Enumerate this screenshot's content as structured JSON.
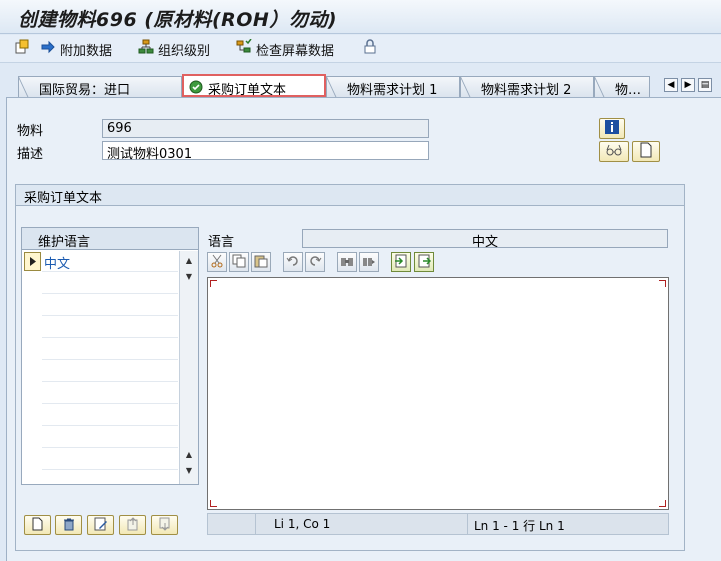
{
  "window": {
    "title": "创建物料696 (原材料(ROH）勿动)"
  },
  "toolbar": {
    "items": [
      {
        "label": "",
        "icon": "new-doc-icon"
      },
      {
        "label": "附加数据",
        "icon": "arrow-right-icon"
      },
      {
        "label": "组织级别",
        "icon": "org-hierarchy-icon"
      },
      {
        "label": "检查屏幕数据",
        "icon": "check-hierarchy-icon"
      },
      {
        "label": "",
        "icon": "lock-icon"
      }
    ]
  },
  "tabs": [
    {
      "label": "国际贸易：进口",
      "active": false
    },
    {
      "label": "采购订单文本",
      "active": true
    },
    {
      "label": "物料需求计划 1",
      "active": false
    },
    {
      "label": "物料需求计划 2",
      "active": false
    },
    {
      "label": "物…",
      "active": false
    }
  ],
  "header": {
    "material_label": "物料",
    "material_value": "696",
    "description_label": "描述",
    "description_value": "测试物料0301"
  },
  "group": {
    "title": "采购订单文本",
    "lang_table_header": "维护语言",
    "lang_rows": [
      "中文",
      "",
      "",
      "",
      "",
      "",
      "",
      "",
      "",
      ""
    ],
    "language_label": "语言",
    "language_value": "中文"
  },
  "status": {
    "position": "Li 1, Co 1",
    "lines": "Ln 1 - 1 行 Ln 1"
  },
  "colors": {
    "title_bg": "#dde8f4",
    "active_tab_border": "#e06060",
    "button_yellow": "#f2e8b6",
    "content_bg": "#e9f0f8"
  }
}
